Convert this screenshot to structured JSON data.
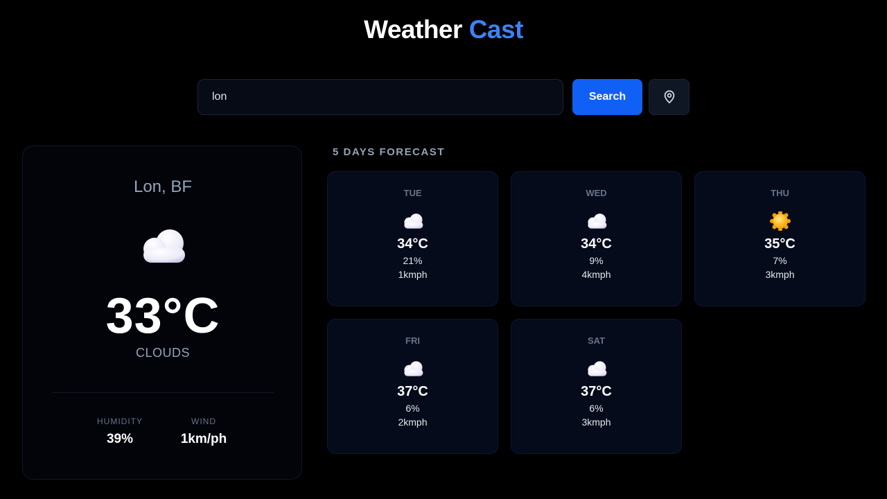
{
  "header": {
    "title_main": "Weather",
    "title_accent": "Cast",
    "accent_color": "#3b82f6"
  },
  "search": {
    "value": "lon",
    "button_label": "Search",
    "location_icon": "map-pin-icon",
    "button_color": "#1160f5"
  },
  "current": {
    "city": "Lon, BF",
    "icon": "cloud-icon",
    "temperature": "33°C",
    "condition": "CLOUDS",
    "humidity_label": "HUMIDITY",
    "humidity_value": "39%",
    "wind_label": "WIND",
    "wind_value": "1km/ph"
  },
  "forecast": {
    "heading": "5 DAYS FORECAST",
    "days": [
      {
        "day": "TUE",
        "icon": "cloud-icon",
        "temp": "34°C",
        "humidity": "21%",
        "wind": "1kmph"
      },
      {
        "day": "WED",
        "icon": "cloud-icon",
        "temp": "34°C",
        "humidity": "9%",
        "wind": "4kmph"
      },
      {
        "day": "THU",
        "icon": "sun-icon",
        "temp": "35°C",
        "humidity": "7%",
        "wind": "3kmph"
      },
      {
        "day": "FRI",
        "icon": "cloud-icon",
        "temp": "37°C",
        "humidity": "6%",
        "wind": "2kmph"
      },
      {
        "day": "SAT",
        "icon": "cloud-icon",
        "temp": "37°C",
        "humidity": "6%",
        "wind": "3kmph"
      }
    ]
  }
}
